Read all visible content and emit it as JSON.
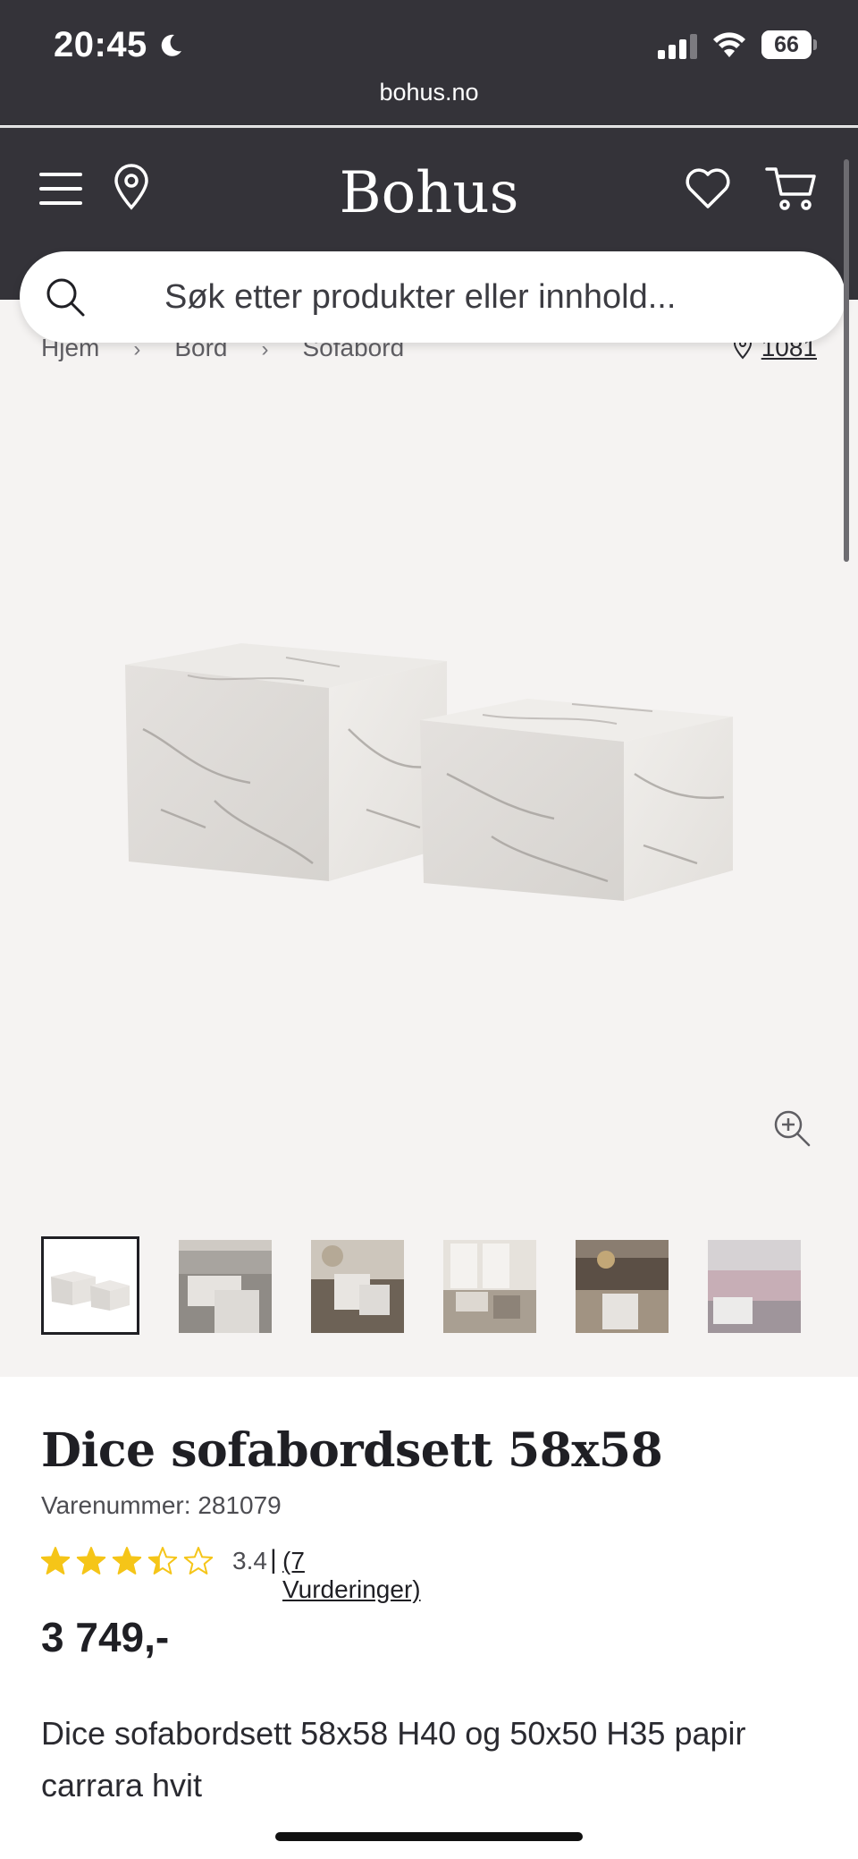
{
  "status_bar": {
    "time": "20:45",
    "battery": "66",
    "battery_level": 0.66,
    "url": "bohus.no"
  },
  "header": {
    "logo": "Bohus"
  },
  "search": {
    "placeholder": "Søk etter produkter eller innhold..."
  },
  "breadcrumb": {
    "items": [
      "Hjem",
      "Bord",
      "Sofabord"
    ],
    "separator": "›",
    "store_code": "1081"
  },
  "thumbnails": {
    "count": 6,
    "active_index": 0
  },
  "product": {
    "title": "Dice sofabordsett 58x58",
    "sku": "Varenummer: 281079",
    "rating": "3.4",
    "rating_value": 3.4,
    "rating_separator": "|",
    "rating_count": "(7 Vurderinger)",
    "price": "3 749,-",
    "description": "Dice sofabordsett 58x58 H40 og 50x50 H35 papir carrara hvit"
  },
  "colors": {
    "header_bg": "#343339",
    "gallery_bg": "#f5f3f2",
    "star": "#f5c518",
    "text": "#1f1f24"
  }
}
